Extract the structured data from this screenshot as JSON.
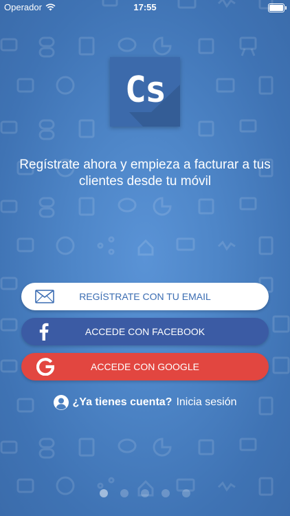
{
  "status_bar": {
    "carrier": "Operador",
    "time": "17:55"
  },
  "logo": {
    "text": "Cs"
  },
  "tagline": {
    "line1": "Regístrate ahora y empieza a facturar a tus",
    "line2": "clientes desde tu móvil"
  },
  "buttons": {
    "email": "REGÍSTRATE CON TU EMAIL",
    "facebook": "ACCEDE CON FACEBOOK",
    "google": "ACCEDE CON GOOGLE"
  },
  "login": {
    "question": "¿Ya tienes cuenta?",
    "link": "Inicia sesión"
  },
  "pagination": {
    "pages": 5,
    "current": 1
  },
  "colors": {
    "email_text": "#3a6cb2",
    "facebook": "#3b5ba4",
    "google": "#e24640"
  }
}
